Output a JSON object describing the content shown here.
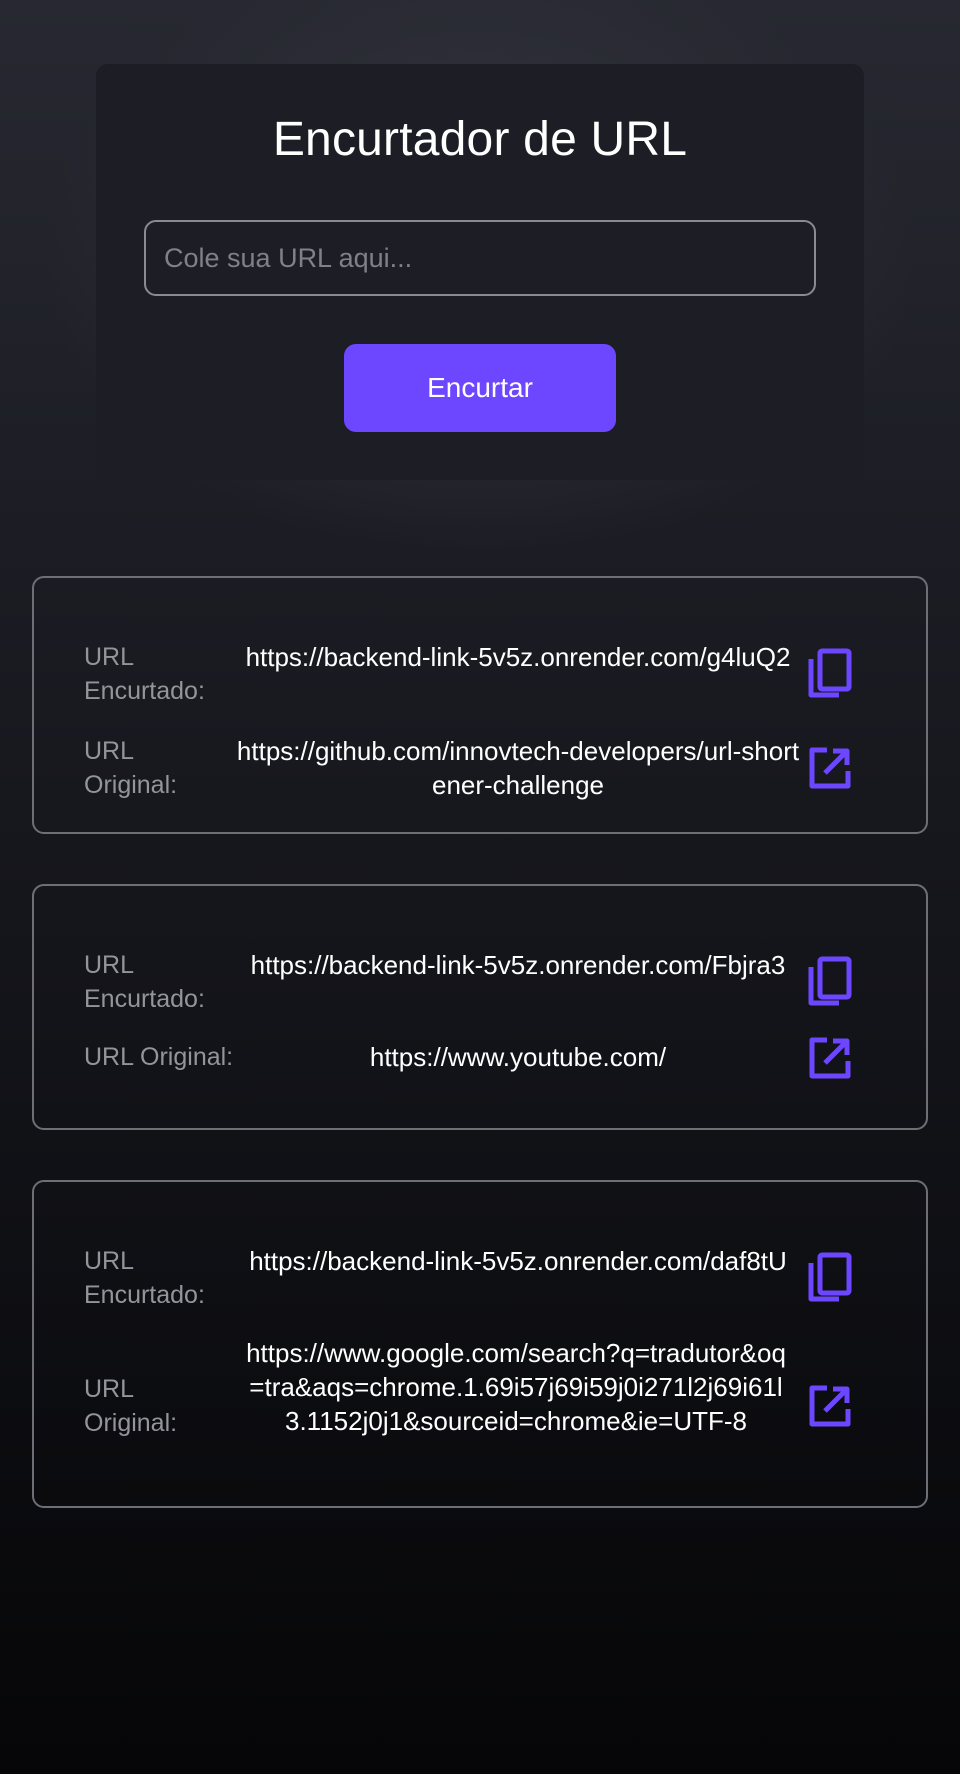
{
  "app": {
    "title": "Encurtador de URL",
    "input_placeholder": "Cole sua URL aqui...",
    "input_value": "",
    "button_label": "Encurtar"
  },
  "labels": {
    "short_url_1": "URL",
    "short_url_2": "Encurtado:",
    "original_url_1": "URL",
    "original_url_2": "Original:",
    "original_url_inline": "URL Original:"
  },
  "icons": {
    "copy": "copy-icon",
    "open": "open-external-icon"
  },
  "colors": {
    "accent": "#6c47ff",
    "background_top": "#272831",
    "background_bottom": "#060608",
    "card_border": "#6e6f76",
    "label_text": "#94959b"
  },
  "results": [
    {
      "short_url": "https://backend-link-5v5z.onrender.com/g4luQ2",
      "original_url": "https://github.com/innovtech-developers/url-shortener-challenge"
    },
    {
      "short_url": "https://backend-link-5v5z.onrender.com/Fbjra3",
      "original_url": "https://www.youtube.com/"
    },
    {
      "short_url": "https://backend-link-5v5z.onrender.com/daf8tU",
      "original_url": "https://www.google.com/search?q=tradutor&oq=tra&aqs=chrome.1.69i57j69i59j0i271l2j69i61l3.1152j0j1&sourceid=chrome&ie=UTF-8"
    }
  ]
}
